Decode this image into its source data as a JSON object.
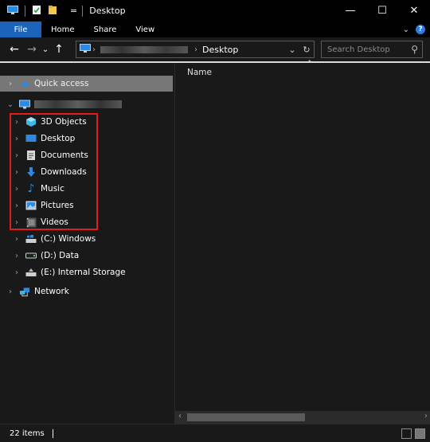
{
  "window": {
    "title": "Desktop",
    "quick_access_separator": "="
  },
  "ribbon": {
    "tabs": [
      "File",
      "Home",
      "Share",
      "View"
    ],
    "help": "?"
  },
  "address": {
    "back": "←",
    "forward": "→",
    "recent": "⌄",
    "up": "↑",
    "crumb": "Desktop",
    "dropdown": "⌄",
    "refresh": "↻"
  },
  "search": {
    "placeholder": "Search Desktop"
  },
  "nav": {
    "quick_access": "Quick access",
    "this_pc_children": [
      {
        "label": "3D Objects",
        "icon": "cube-icon",
        "color": "#3fb8e8"
      },
      {
        "label": "Desktop",
        "icon": "desktop-icon",
        "color": "#2d8ae0"
      },
      {
        "label": "Documents",
        "icon": "documents-icon",
        "color": "#d8d8d8"
      },
      {
        "label": "Downloads",
        "icon": "downloads-icon",
        "color": "#2d8ae0"
      },
      {
        "label": "Music",
        "icon": "music-icon",
        "color": "#2d8ae0"
      },
      {
        "label": "Pictures",
        "icon": "pictures-icon",
        "color": "#cfcfcf"
      },
      {
        "label": "Videos",
        "icon": "videos-icon",
        "color": "#bbbbbb"
      }
    ],
    "drives": [
      {
        "label": "(C:) Windows",
        "icon": "windows-drive-icon"
      },
      {
        "label": "(D:) Data",
        "icon": "drive-icon"
      },
      {
        "label": "(E:) Internal Storage",
        "icon": "usb-drive-icon"
      }
    ],
    "network": "Network"
  },
  "content": {
    "column_name": "Name"
  },
  "status": {
    "items": "22 items"
  },
  "colors": {
    "file_tab": "#1a63b8",
    "highlight_box": "#e21b1b",
    "quick_access_bg": "#777777"
  }
}
